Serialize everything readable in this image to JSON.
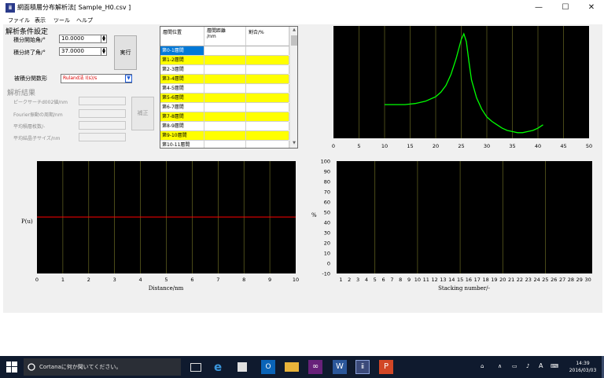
{
  "window": {
    "title": "網面積層分布解析法[ Sample_H0.csv ]",
    "icon_text": "ⅱ",
    "minimize": "—",
    "maximize": "☐",
    "close": "✕"
  },
  "menu": [
    "ファイル",
    "表示",
    "ツール",
    "ヘルプ"
  ],
  "analysis_settings": {
    "title": "解析条件設定",
    "start_angle_label": "積分開始角/°",
    "start_angle_value": "10.0000",
    "end_angle_label": "積分終了角/°",
    "end_angle_value": "37.0000",
    "run_button": "実行",
    "func_label": "被積分関数形",
    "func_value": "Ruland法 I(s)/s"
  },
  "results": {
    "title": "解析結果",
    "peak_label": "ピークサーチd002値/nm",
    "fourier_label": "Fourier振動の周期/nm",
    "avg_layers_label": "平均積層枚数/-",
    "crystal_label": "平均結晶子サイズ/nm",
    "fix_button": "補正"
  },
  "grid": {
    "headers": [
      "層間位置",
      "層間距離\n/nm",
      "割合/%"
    ],
    "rows": [
      "第0-1層間",
      "第1-2層間",
      "第2-3層間",
      "第3-4層間",
      "第4-5層間",
      "第5-6層間",
      "第6-7層間",
      "第7-8層間",
      "第8-9層間",
      "第9-10層間",
      "第10-11層間"
    ]
  },
  "chart_data": [
    {
      "type": "line",
      "name": "xrd-profile",
      "xlim": [
        0,
        50
      ],
      "x_ticks": [
        0,
        5,
        10,
        15,
        20,
        25,
        30,
        35,
        40,
        45,
        50
      ],
      "series": [
        {
          "color": "#00ff00",
          "x": [
            10,
            12,
            14,
            16,
            18,
            20,
            21,
            22,
            23,
            24,
            25,
            25.5,
            26,
            26.5,
            27,
            28,
            29,
            30,
            31,
            32,
            33,
            34,
            35,
            36,
            37,
            38,
            39,
            40,
            41
          ],
          "y": [
            0.3,
            0.3,
            0.3,
            0.31,
            0.33,
            0.37,
            0.41,
            0.47,
            0.57,
            0.71,
            0.88,
            0.93,
            0.86,
            0.68,
            0.52,
            0.36,
            0.26,
            0.19,
            0.15,
            0.12,
            0.09,
            0.07,
            0.06,
            0.05,
            0.05,
            0.06,
            0.07,
            0.09,
            0.12
          ]
        }
      ]
    },
    {
      "type": "line",
      "name": "pair-distribution",
      "ylabel": "P(u)",
      "xlabel": "Distance/nm",
      "xlim": [
        0,
        10
      ],
      "x_ticks": [
        0,
        1,
        2,
        3,
        4,
        5,
        6,
        7,
        8,
        9,
        10
      ],
      "series": [
        {
          "color": "#ff0000",
          "x": [
            0,
            10
          ],
          "y": [
            0,
            0
          ]
        }
      ]
    },
    {
      "type": "bar",
      "name": "stacking-distribution",
      "ylabel": "%",
      "xlabel": "Stacking number/-",
      "ylim": [
        -10,
        100
      ],
      "y_ticks": [
        -10,
        0,
        10,
        20,
        30,
        40,
        50,
        60,
        70,
        80,
        90,
        100
      ],
      "categories": [
        1,
        2,
        3,
        4,
        5,
        6,
        7,
        8,
        9,
        10,
        11,
        12,
        13,
        14,
        15,
        16,
        17,
        18,
        19,
        20,
        21,
        22,
        23,
        24,
        25,
        26,
        27,
        28,
        29,
        30
      ],
      "values": []
    }
  ],
  "taskbar": {
    "search_placeholder": "Cortanaに何か聞いてください。",
    "ime": "A",
    "time": "14:39",
    "date": "2016/03/03"
  }
}
